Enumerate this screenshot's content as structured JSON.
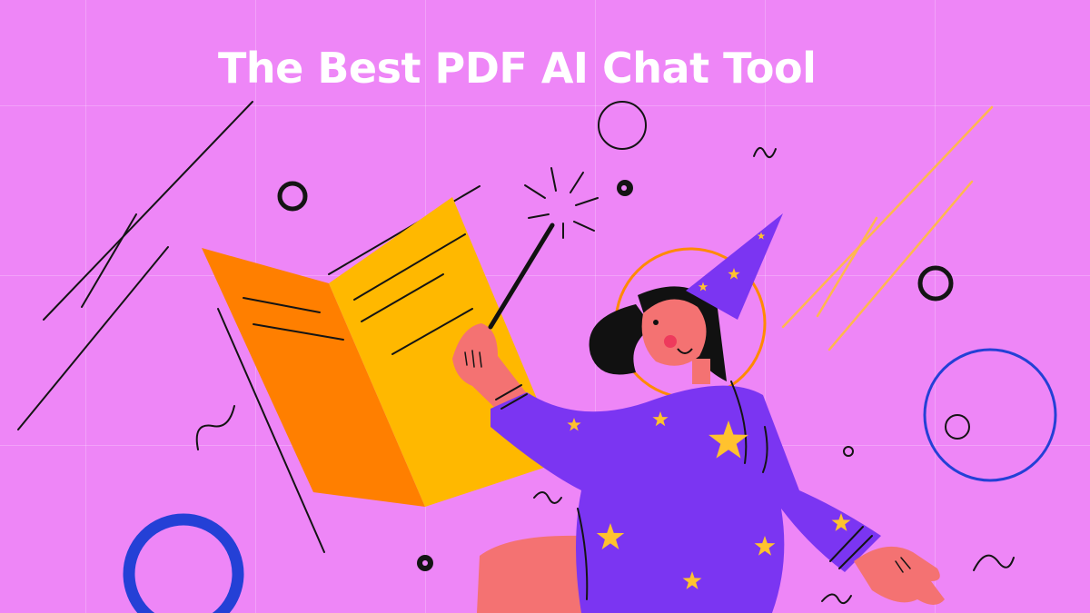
{
  "banner": {
    "title": "The Best PDF AI Chat Tool"
  },
  "colors": {
    "background": "#ee86f7",
    "title_text": "#ffffff",
    "book_left_page": "#ff7f00",
    "book_right_page": "#ffb800",
    "robe": "#7b35f2",
    "stars": "#ffc22e",
    "skin": "#f47272",
    "hair": "#111111",
    "halo": "#ff8a00",
    "blue_ring": "#2440d6",
    "accent_lines": "#ffb84d"
  },
  "icons": {
    "wand": "magic-wand-icon",
    "sparkle": "sparkle-icon",
    "star": "star-icon"
  }
}
